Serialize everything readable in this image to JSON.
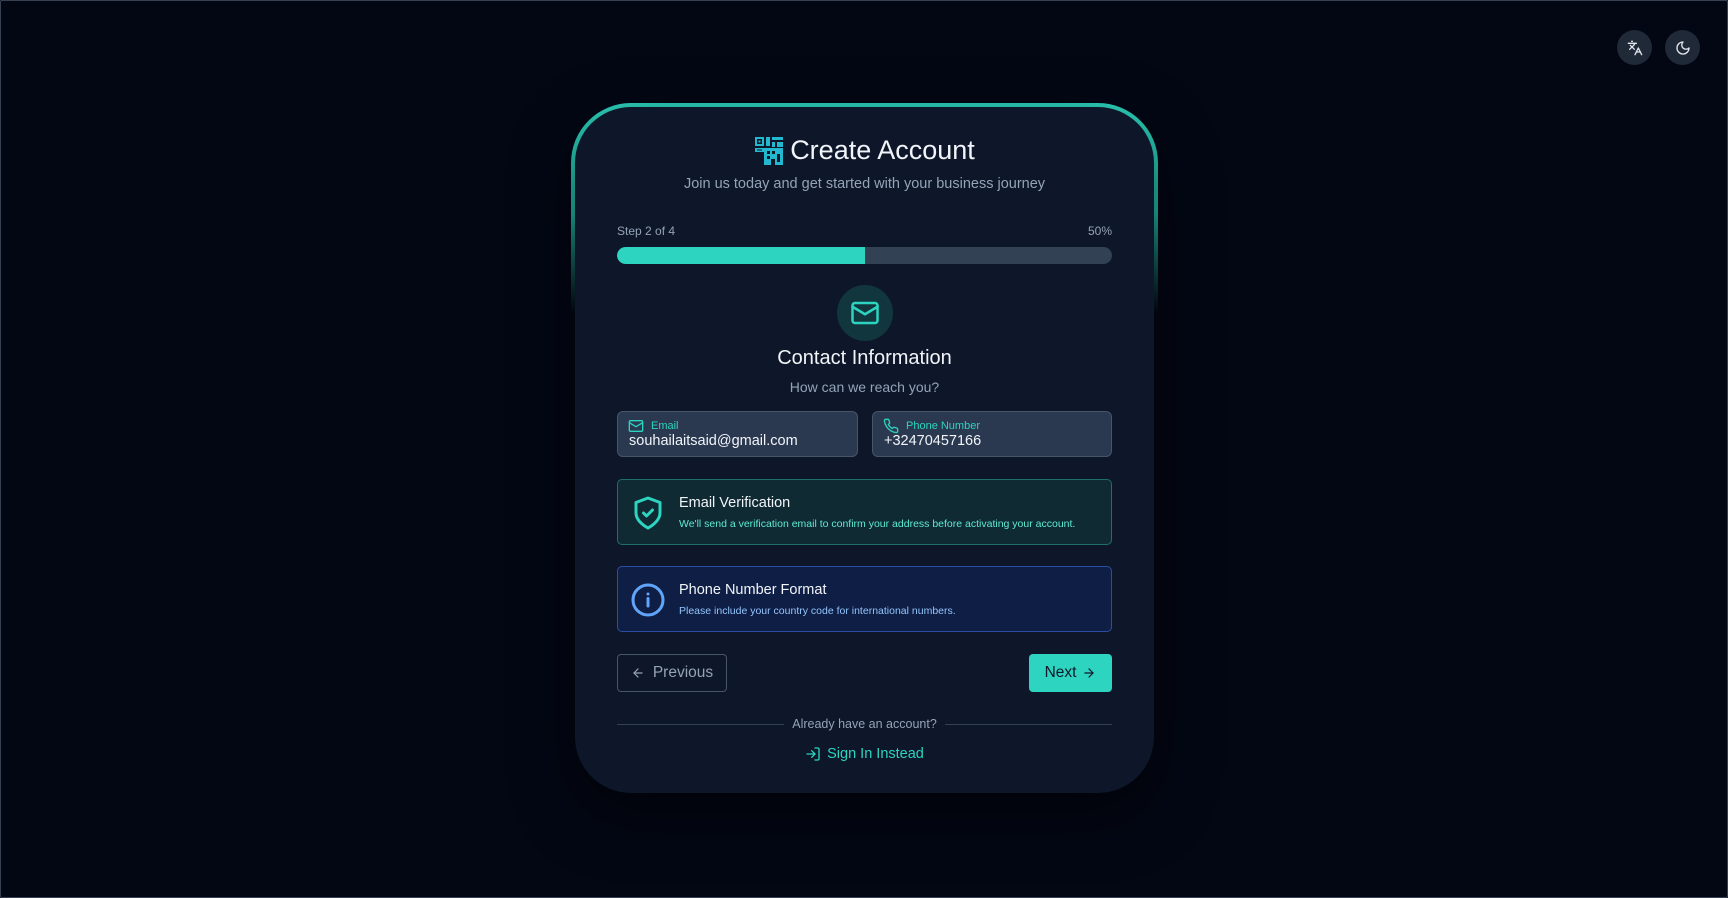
{
  "header": {
    "translate_icon": "translate-icon",
    "theme_icon": "moon-icon"
  },
  "card": {
    "title": "Create Account",
    "subtitle": "Join us today and get started with your business journey",
    "step_label": "Step 2 of 4",
    "progress_percent_label": "50%",
    "progress_fraction": 0.5,
    "section_icon": "mail-icon",
    "section_title": "Contact Information",
    "section_subtitle": "How can we reach you?"
  },
  "fields": {
    "email": {
      "label": "Email",
      "value": "souhailaitsaid@gmail.com",
      "icon": "mail-icon"
    },
    "phone": {
      "label": "Phone Number",
      "value": "+32470457166",
      "icon": "phone-icon"
    }
  },
  "notices": {
    "email_verification": {
      "title": "Email Verification",
      "text": "We'll send a verification email to confirm your address before activating your account.",
      "icon": "shield-check-icon"
    },
    "phone_format": {
      "title": "Phone Number Format",
      "text": "Please include your country code for international numbers.",
      "icon": "info-icon"
    }
  },
  "actions": {
    "previous_label": "Previous",
    "next_label": "Next",
    "already_account": "Already have an account?",
    "sign_in_label": "Sign In Instead"
  },
  "colors": {
    "accent": "#2dd4bf",
    "background": "#030712",
    "card": "#0e1629",
    "info": "#60a5fa"
  }
}
